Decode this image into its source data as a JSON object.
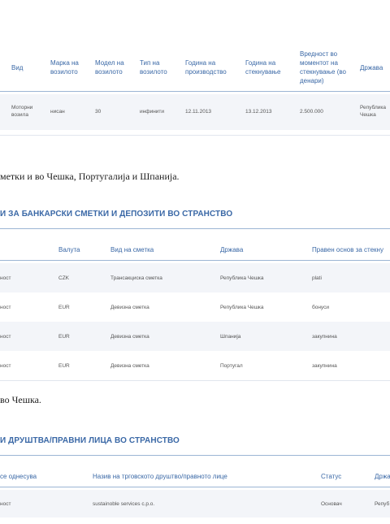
{
  "vehicles": {
    "headers": {
      "vid": "Вид",
      "marka": "Марка на возилото",
      "model": "Модел на возилото",
      "tip": "Тип на возилото",
      "godina_proizvodstvo": "Година на производство",
      "godina_steknuvanje": "Година на стекнување",
      "vrednost": "Вредност во моментот на стекнување (во денари)",
      "drzava": "Држава"
    },
    "row": {
      "vid": "Моторни возила",
      "marka": "нисан",
      "model": "30",
      "tip": "инфинити",
      "godina_proizvodstvo": "12.11.2013",
      "godina_steknuvanje": "13.12.2013",
      "vrednost": "2.500.000",
      "drzava": "Република Чешка"
    }
  },
  "paragraph_1": "метки и во Чешка, Португалија и Шпанија.",
  "bank_section": {
    "title": "И ЗА БАНКАРСКИ СМЕТКИ И ДЕПОЗИТИ ВО СТРАНСТВО",
    "headers": {
      "valuta": "Валута",
      "vid_smetka": "Вид на сметка",
      "drzava": "Држава",
      "osnov": "Правен основ за стекну"
    },
    "rows": [
      {
        "lead": "ност",
        "valuta": "CZK",
        "vid_smetka": "Трансакциска сметка",
        "drzava": "Република Чешка",
        "osnov": "plati"
      },
      {
        "lead": "ност",
        "valuta": "EUR",
        "vid_smetka": "Девизна сметка",
        "drzava": "Република Чешка",
        "osnov": "бонуси"
      },
      {
        "lead": "ност",
        "valuta": "EUR",
        "vid_smetka": "Девизна сметка",
        "drzava": "Шпанија",
        "osnov": "закупнина"
      },
      {
        "lead": "ност",
        "valuta": "EUR",
        "vid_smetka": "Девизна сметка",
        "drzava": "Португал",
        "osnov": "закупнина"
      }
    ]
  },
  "paragraph_2": "во Чешка.",
  "company_section": {
    "title": "И ДРУШТВА/ПРАВНИ ЛИЦА ВО СТРАНСТВО",
    "headers": {
      "se_odnesuva": "се однесува",
      "naziv": "Назив на трговското друштво/правното лице",
      "status": "Статус",
      "drzava": "Држа"
    },
    "row": {
      "lead": "ност",
      "naziv": "sustainoble services c.p.o.",
      "status": "Основач",
      "drzava": "Репуб"
    }
  }
}
